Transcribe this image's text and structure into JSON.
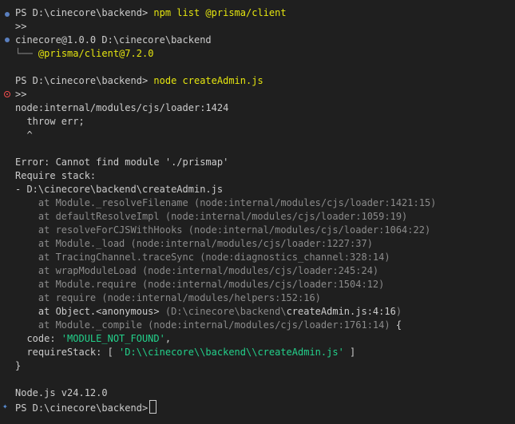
{
  "prompt1": {
    "prompt": "PS D:\\cinecore\\backend>",
    "command": "npm list @prisma/client",
    "continuation": ">>"
  },
  "npm_output": {
    "package": "cinecore@1.0.0 D:\\cinecore\\backend",
    "tree_branch": "└──",
    "dependency": "@prisma/client@7.2.0"
  },
  "prompt2": {
    "prompt": "PS D:\\cinecore\\backend>",
    "command": "node createAdmin.js",
    "continuation": ">>"
  },
  "error": {
    "loader": "node:internal/modules/cjs/loader:1424",
    "throw": "  throw err;",
    "caret": "  ^",
    "message": "Error: Cannot find module './prismap'",
    "require_stack_label": "Require stack:",
    "require_stack_entry": "- D:\\cinecore\\backend\\createAdmin.js",
    "stack": [
      "    at Module._resolveFilename (node:internal/modules/cjs/loader:1421:15)",
      "    at defaultResolveImpl (node:internal/modules/cjs/loader:1059:19)",
      "    at resolveForCJSWithHooks (node:internal/modules/cjs/loader:1064:22)",
      "    at Module._load (node:internal/modules/cjs/loader:1227:37)",
      "    at TracingChannel.traceSync (node:diagnostics_channel:328:14)",
      "    at wrapModuleLoad (node:internal/modules/cjs/loader:245:24)",
      "    at Module.require (node:internal/modules/cjs/loader:1504:12)",
      "    at require (node:internal/modules/helpers:152:16)"
    ],
    "anon_frame": {
      "prefix": "    at Object.<anonymous> ",
      "open": "(D:\\cinecore\\backend\\",
      "file": "createAdmin.js:4:16",
      "close": ")"
    },
    "compile_frame": {
      "text": "    at Module._compile (node:internal/modules/cjs/loader:1761:14)",
      "brace": " {"
    },
    "code_label": "  code: ",
    "code_value": "'MODULE_NOT_FOUND'",
    "code_comma": ",",
    "require_stack_key": "  requireStack: [ ",
    "require_stack_value": "'D:\\\\cinecore\\\\backend\\\\createAdmin.js'",
    "require_stack_close": " ]",
    "close_brace": "}"
  },
  "node_version": "Node.js v24.12.0",
  "prompt3": {
    "prompt": "PS D:\\cinecore\\backend>"
  },
  "colors": {
    "background": "#1f1f1f",
    "text": "#cccccc",
    "dim": "#8b8b8b",
    "yellow": "#e5e510",
    "string_green": "#23d18b",
    "decoration_blue": "#5a7fbf",
    "decoration_error": "#f14c4c"
  },
  "icons": {
    "success_decoration": "circle-dot-icon",
    "error_decoration": "error-circle-icon",
    "ai_sparkle": "sparkle-icon"
  }
}
